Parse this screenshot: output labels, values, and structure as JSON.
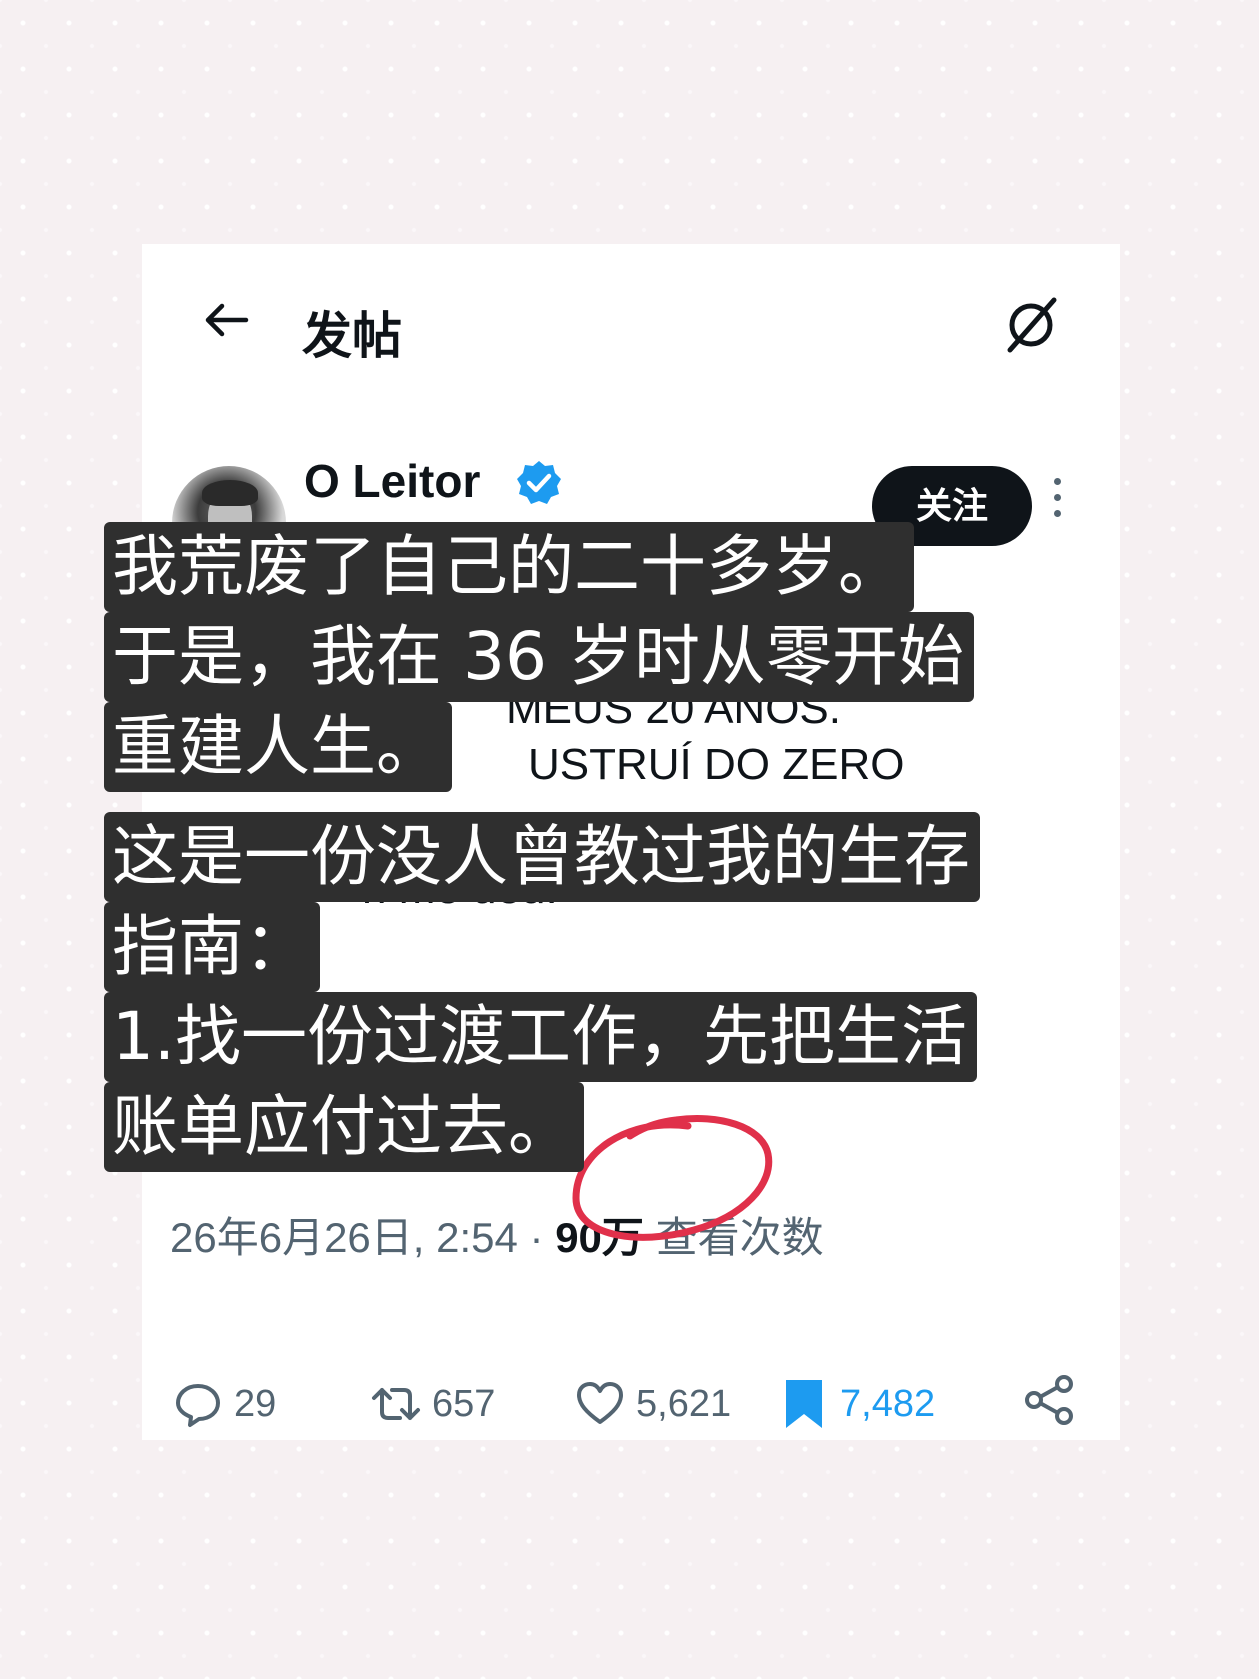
{
  "topbar": {
    "title": "发帖"
  },
  "author": {
    "name": "O Leitor",
    "follow_label": "关注"
  },
  "post": {
    "lines": [
      {
        "text": "MEUS 20 ANOS.",
        "muted": false
      },
      {
        "text": "USTRUÍ DO ZERO",
        "muted": false
      },
      {
        "text": "n me deu:",
        "muted": false
      }
    ]
  },
  "meta": {
    "datetime": "26年6月26日, 2:54",
    "separator": " · ",
    "views": "90万",
    "views_label": " 查看次数"
  },
  "actions": {
    "replies": "29",
    "reposts": "657",
    "likes": "5,621",
    "bookmarks": "7,482"
  },
  "overlay": {
    "lines": [
      "我荒废了自己的二十多岁。",
      "于是，我在 36 岁时从零开始",
      "重建人生。",
      "这是一份没人曾教过我的生存",
      "指南：",
      "1.找一份过渡工作，先把生活",
      "账单应付过去。"
    ]
  },
  "colors": {
    "overlay_bg": "#2f2f2f",
    "verified": "#1d9bf0",
    "bookmark": "#1d9bf0",
    "annotation": "#e0304a"
  }
}
